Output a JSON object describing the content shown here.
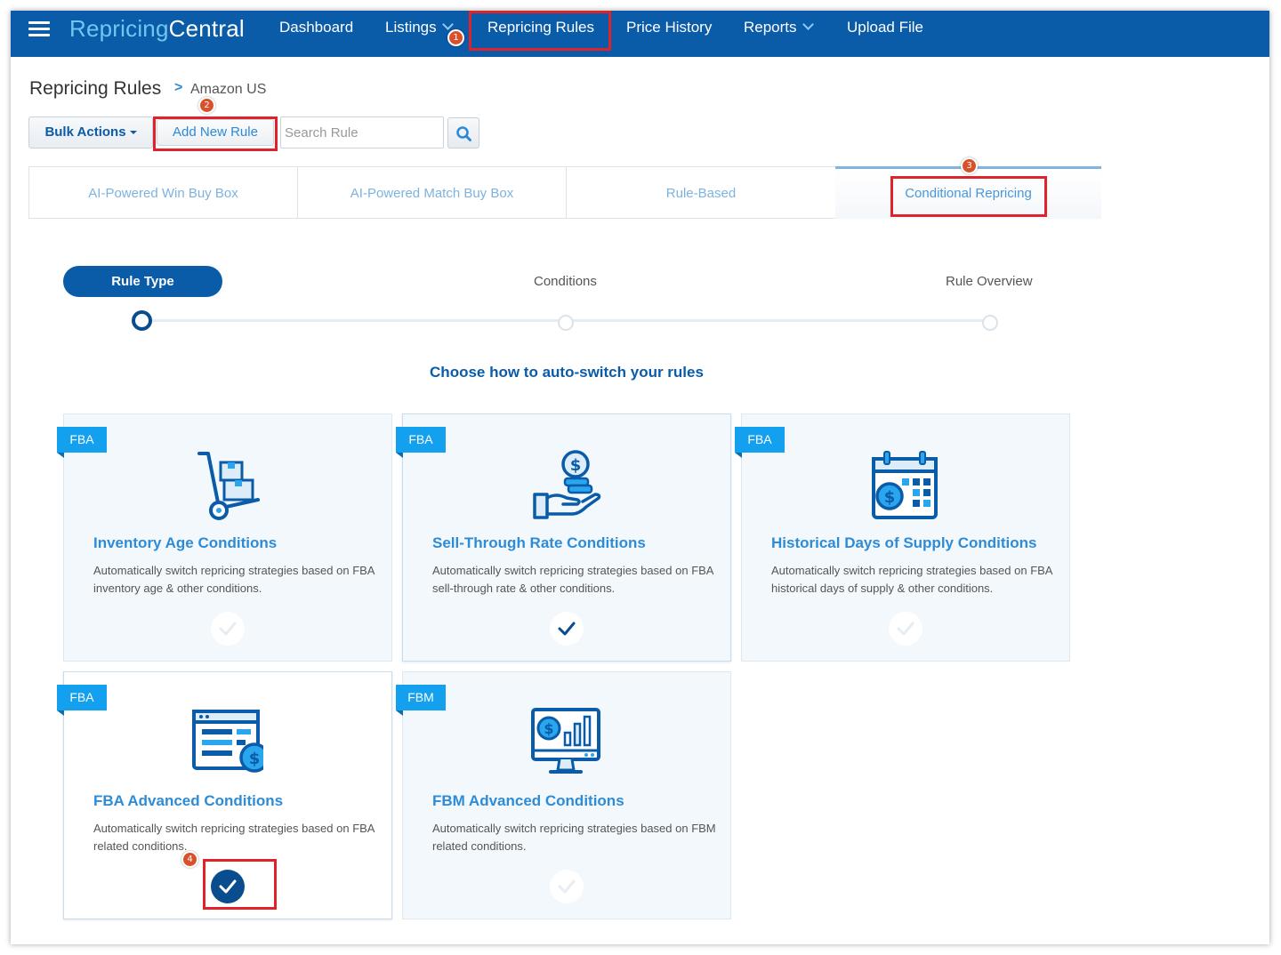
{
  "nav": {
    "brand_part1": "Repricing",
    "brand_part2": "Central",
    "items": [
      "Dashboard",
      "Listings",
      "Repricing Rules",
      "Price History",
      "Reports",
      "Upload File"
    ]
  },
  "breadcrumb": {
    "title": "Repricing Rules",
    "separator": ">",
    "sub": "Amazon US"
  },
  "toolbar": {
    "bulk_label": "Bulk Actions",
    "add_label": "Add New Rule",
    "search_placeholder": "Search Rule"
  },
  "tabs": [
    "AI-Powered Win Buy Box",
    "AI-Powered Match Buy Box",
    "Rule-Based",
    "Conditional Repricing"
  ],
  "active_tab": "Conditional Repricing",
  "steps": [
    "Rule Type",
    "Conditions",
    "Rule Overview"
  ],
  "heading": "Choose how to auto-switch your rules",
  "cards": [
    {
      "badge": "FBA",
      "icon": "hand-truck-icon",
      "title": "Inventory Age Conditions",
      "desc": "Automatically switch repricing strategies based on FBA inventory age & other conditions.",
      "selected": false
    },
    {
      "badge": "FBA",
      "icon": "hand-coins-icon",
      "title": "Sell-Through Rate Conditions",
      "desc": "Automatically switch repricing strategies based on FBA sell-through rate & other conditions.",
      "selected": false
    },
    {
      "badge": "FBA",
      "icon": "calendar-dollar-icon",
      "title": "Historical Days of Supply Conditions",
      "desc": "Automatically switch repricing strategies based on FBA historical days of supply & other conditions.",
      "selected": false
    },
    {
      "badge": "FBA",
      "icon": "list-dollar-icon",
      "title": "FBA Advanced Conditions",
      "desc": "Automatically switch repricing strategies based on FBA related conditions.",
      "selected": true
    },
    {
      "badge": "FBM",
      "icon": "monitor-chart-icon",
      "title": "FBM Advanced Conditions",
      "desc": "Automatically switch repricing strategies based on FBM related conditions.",
      "selected": false
    }
  ],
  "markers": [
    "1",
    "2",
    "3",
    "4"
  ],
  "colors": {
    "brand_blue": "#0a5ba8",
    "accent_blue": "#2e8bd6",
    "badge_blue": "#13a0ee",
    "highlight_red": "#e0222b",
    "marker_orange": "#d9502b"
  }
}
